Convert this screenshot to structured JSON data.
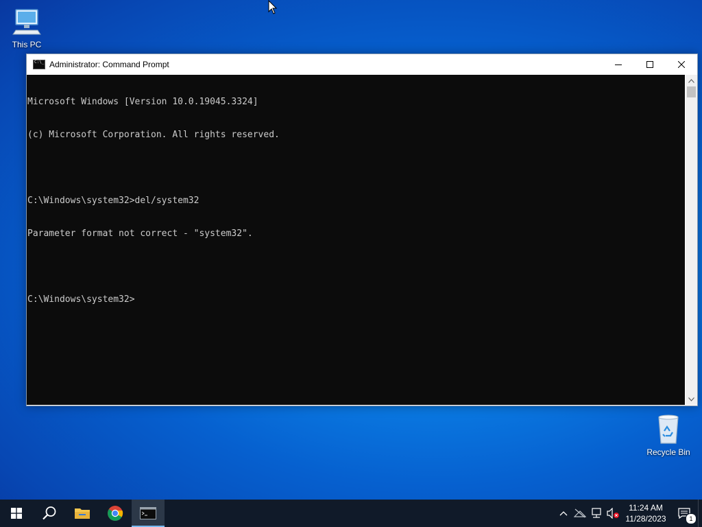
{
  "desktop": {
    "icons": [
      {
        "label": "This PC",
        "icon": "computer-icon"
      },
      {
        "label": "Recycle Bin",
        "icon": "recycle-bin-icon"
      }
    ]
  },
  "window": {
    "title": "Administrator: Command Prompt",
    "app_icon": "cmd-icon",
    "controls": {
      "minimize": "minimize-icon",
      "maximize": "maximize-icon",
      "close": "close-icon"
    }
  },
  "console": {
    "lines": [
      "Microsoft Windows [Version 10.0.19045.3324]",
      "(c) Microsoft Corporation. All rights reserved.",
      "",
      "C:\\Windows\\system32>del/system32",
      "Parameter format not correct - \"system32\".",
      "",
      "C:\\Windows\\system32>"
    ],
    "background": "#0c0c0c",
    "foreground": "#cccccc"
  },
  "taskbar": {
    "items": [
      {
        "name": "start",
        "icon": "windows-logo-icon"
      },
      {
        "name": "search",
        "icon": "search-icon"
      },
      {
        "name": "file-explorer",
        "icon": "folder-icon"
      },
      {
        "name": "chrome",
        "icon": "chrome-icon"
      },
      {
        "name": "command-prompt",
        "icon": "cmd-icon",
        "active": true
      }
    ],
    "tray": {
      "icons": [
        "chevron-up-icon",
        "network-offline-icon",
        "network-icon",
        "volume-muted-icon"
      ],
      "time": "11:24 AM",
      "date": "11/28/2023",
      "notification_count": "1"
    },
    "accent": "#77b9f0"
  }
}
